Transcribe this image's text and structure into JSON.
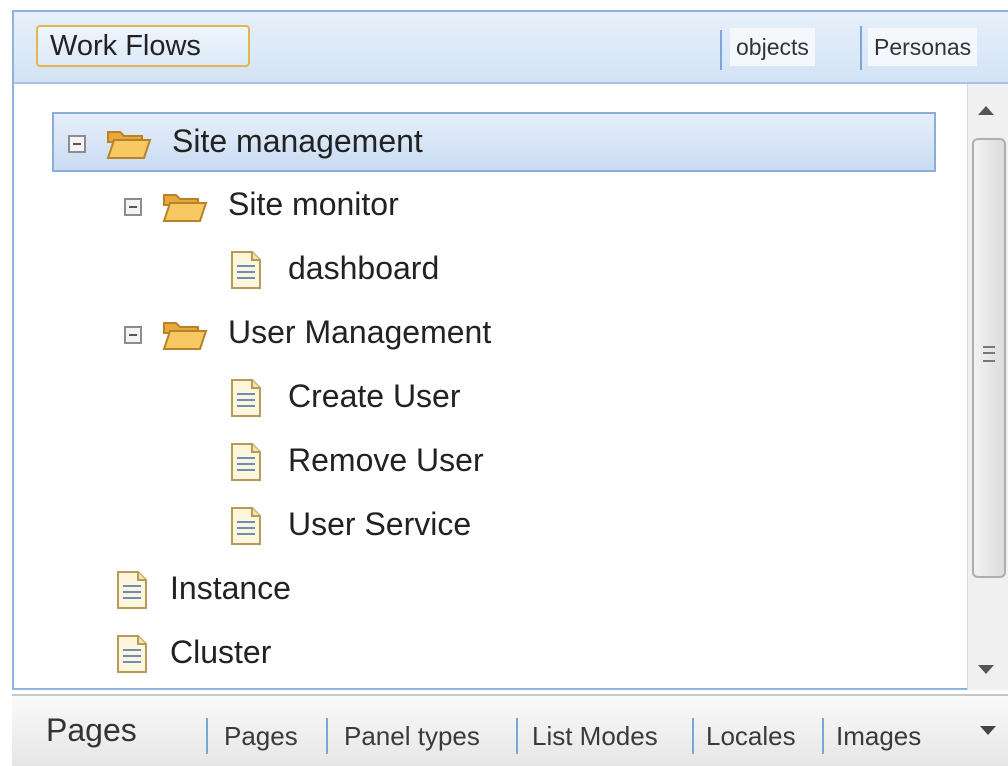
{
  "header": {
    "active_tab": "Work Flows",
    "tabs": [
      "objects",
      "Personas"
    ]
  },
  "tree": {
    "items": [
      {
        "label": "Site management",
        "type": "folder",
        "expanded": true,
        "selected": true
      },
      {
        "label": "Site monitor",
        "type": "folder",
        "expanded": true
      },
      {
        "label": "dashboard",
        "type": "file"
      },
      {
        "label": "User Management",
        "type": "folder",
        "expanded": true
      },
      {
        "label": "Create User",
        "type": "file"
      },
      {
        "label": "Remove User",
        "type": "file"
      },
      {
        "label": "User Service",
        "type": "file"
      },
      {
        "label": "Instance",
        "type": "file"
      },
      {
        "label": "Cluster",
        "type": "file"
      }
    ]
  },
  "bottom_bar": {
    "title": "Pages",
    "tabs": [
      "Pages",
      "Panel types",
      "List Modes",
      "Locales",
      "Images"
    ]
  },
  "colors": {
    "accent_border": "#8eb3dc",
    "active_tab_border": "#e2b74f",
    "folder_fill": "#f5c35a",
    "selection": "#c9dcf2"
  },
  "icons": {
    "folder": "open-folder-icon",
    "file": "document-icon",
    "collapse": "collapse-minus-icon"
  }
}
